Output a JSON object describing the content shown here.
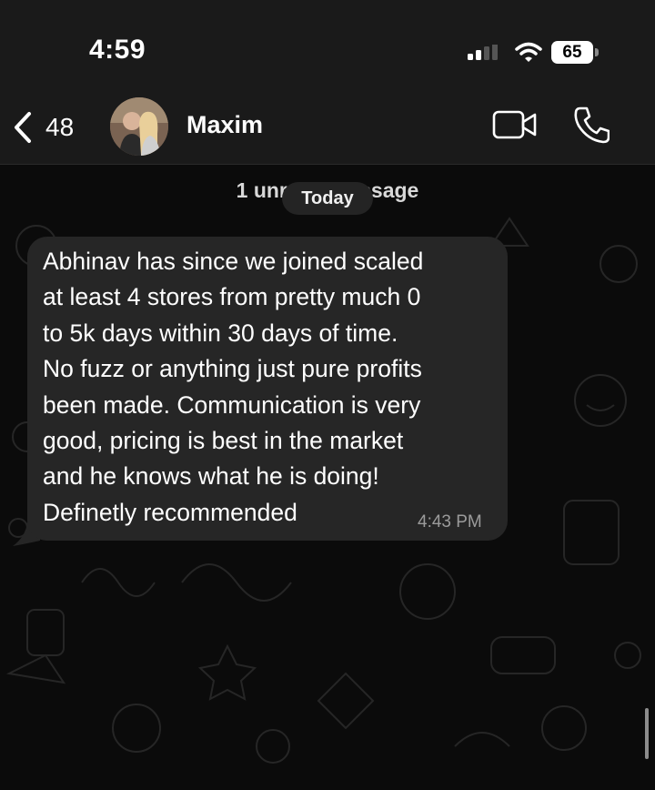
{
  "status_bar": {
    "time": "4:59",
    "battery": "65"
  },
  "header": {
    "back_count": "48",
    "contact_name": "Maxim"
  },
  "chat": {
    "unread_label": "1 unread message",
    "day_label": "Today",
    "message": {
      "text": "Abhinav has since we joined scaled\nat least 4 stores from pretty much 0\nto 5k days within 30 days of time.\nNo fuzz or anything just pure profits\nbeen made. Communication is very\ngood, pricing is best in the market\nand he knows what he is doing!\nDefinetly recommended",
      "time": "4:43 PM"
    }
  },
  "colors": {
    "bubble": "#262626",
    "header": "#1a1a1a",
    "background": "#0b0b0b"
  },
  "icons": [
    "signal-icon",
    "wifi-icon",
    "back-chevron-icon",
    "video-call-icon",
    "phone-icon"
  ]
}
